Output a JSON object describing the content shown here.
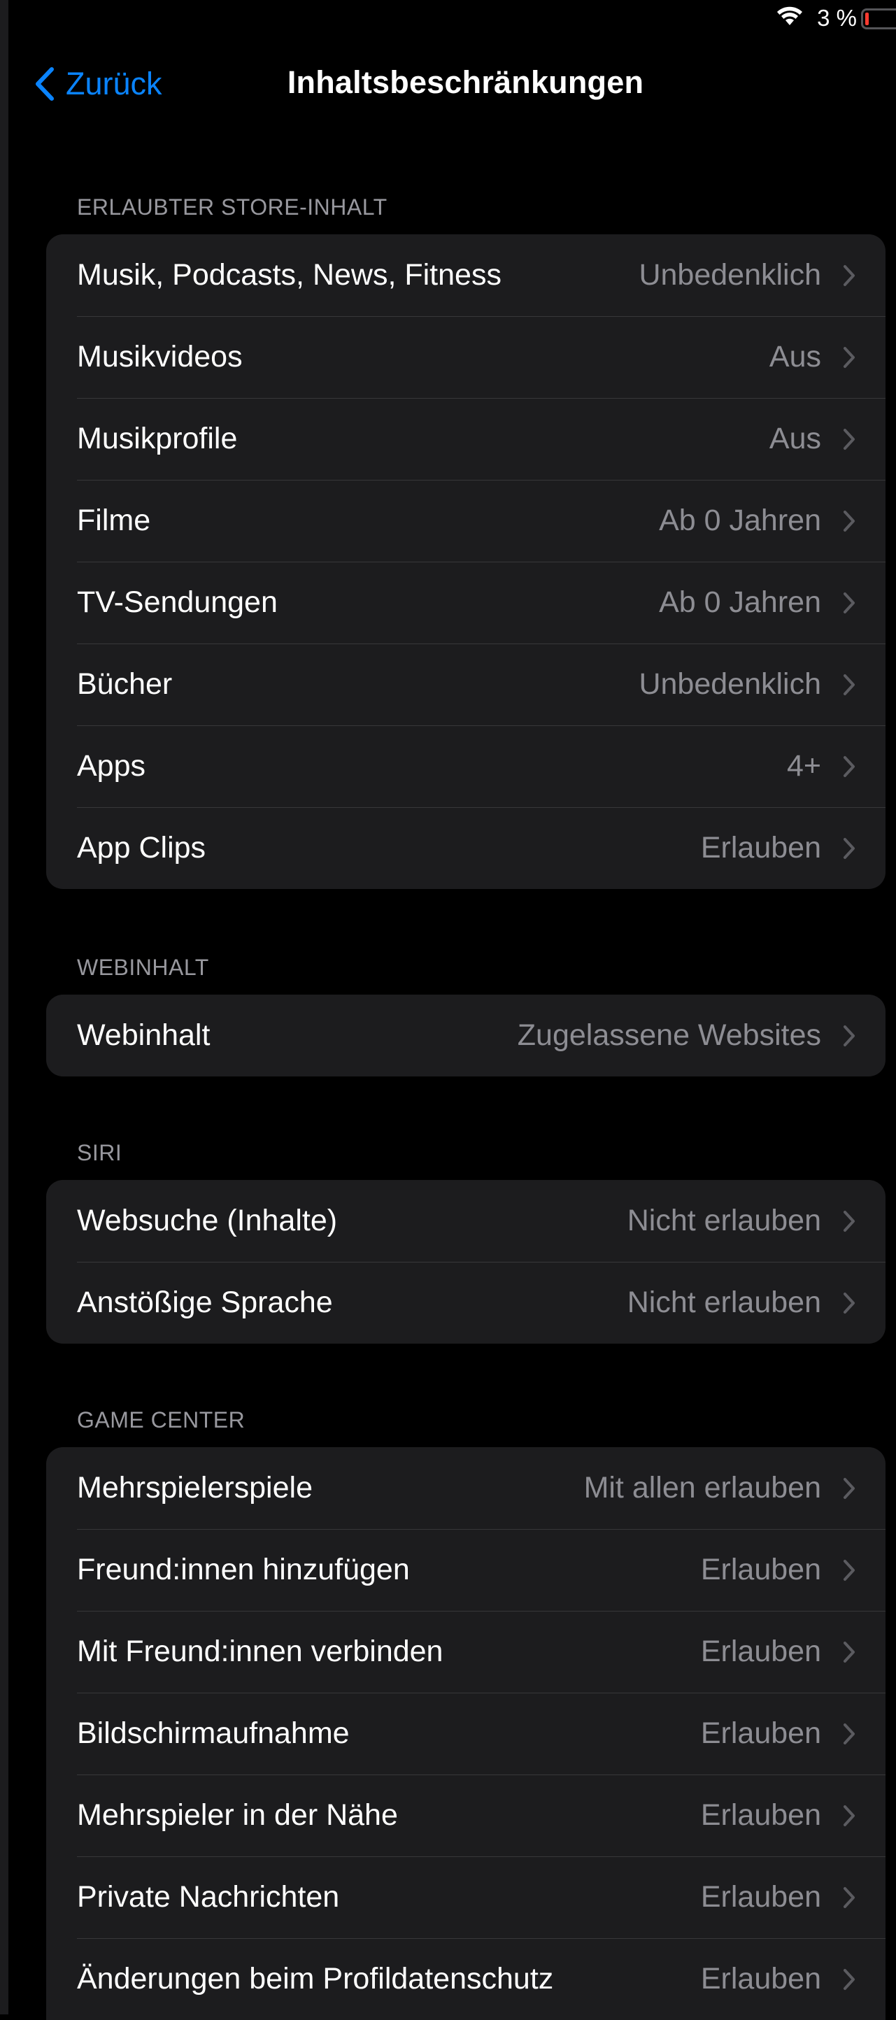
{
  "status": {
    "battery_text": "3 %",
    "battery_color": "#ff3b30"
  },
  "nav": {
    "back_label": "Zurück",
    "title": "Inhaltsbeschränkungen",
    "accent": "#0a84ff"
  },
  "sections": [
    {
      "header": "ERLAUBTER STORE-INHALT",
      "rows": [
        {
          "label": "Musik, Podcasts, News, Fitness",
          "value": "Unbedenklich"
        },
        {
          "label": "Musikvideos",
          "value": "Aus"
        },
        {
          "label": "Musikprofile",
          "value": "Aus"
        },
        {
          "label": "Filme",
          "value": "Ab 0 Jahren"
        },
        {
          "label": "TV-Sendungen",
          "value": "Ab 0 Jahren"
        },
        {
          "label": "Bücher",
          "value": "Unbedenklich"
        },
        {
          "label": "Apps",
          "value": "4+"
        },
        {
          "label": "App Clips",
          "value": "Erlauben"
        }
      ]
    },
    {
      "header": "WEBINHALT",
      "rows": [
        {
          "label": "Webinhalt",
          "value": "Zugelassene Websites"
        }
      ]
    },
    {
      "header": "SIRI",
      "rows": [
        {
          "label": "Websuche (Inhalte)",
          "value": "Nicht erlauben"
        },
        {
          "label": "Anstößige Sprache",
          "value": "Nicht erlauben"
        }
      ]
    },
    {
      "header": "GAME CENTER",
      "rows": [
        {
          "label": "Mehrspielerspiele",
          "value": "Mit allen erlauben"
        },
        {
          "label": "Freund:innen hinzufügen",
          "value": "Erlauben"
        },
        {
          "label": "Mit Freund:innen verbinden",
          "value": "Erlauben"
        },
        {
          "label": "Bildschirmaufnahme",
          "value": "Erlauben"
        },
        {
          "label": "Mehrspieler in der Nähe",
          "value": "Erlauben"
        },
        {
          "label": "Private Nachrichten",
          "value": "Erlauben"
        },
        {
          "label": "Änderungen beim Profildatenschutz",
          "value": "Erlauben"
        }
      ]
    }
  ]
}
